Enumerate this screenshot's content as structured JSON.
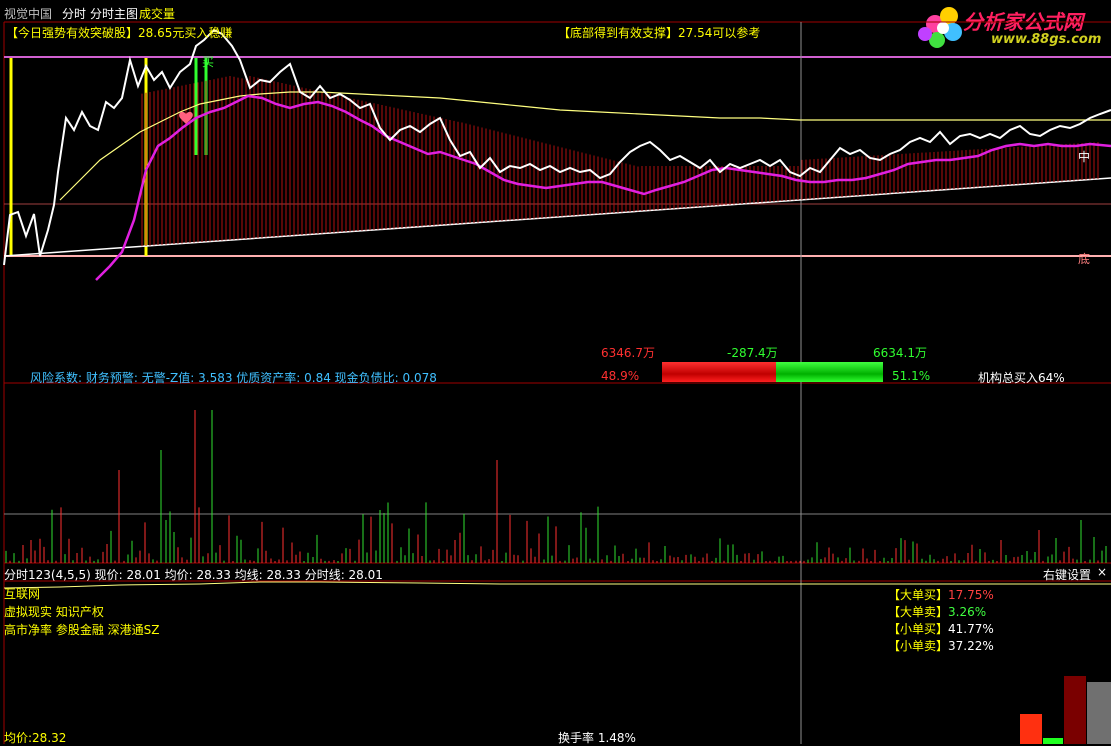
{
  "menu": {
    "items": [
      "视觉中国",
      "分时",
      "分时主图",
      "成交量"
    ],
    "colors": [
      "#c0c0c0",
      "#ffffff",
      "#ffffff",
      "#ffff00"
    ]
  },
  "main_chart": {
    "signal_left": "【今日强势有效突破股】28.65元买入稳赚",
    "signal_right": "【底部得到有效支撑】27.54可以参考",
    "label_mid": "中",
    "label_bottom": "底",
    "buy_tag": "买"
  },
  "money_flow": {
    "left_value": "6346.7万",
    "mid_value": "-287.4万",
    "right_value": "6634.1万",
    "left_pct": "48.9%",
    "right_pct": "51.1%",
    "inst_text": "机构总买入64%",
    "risk_text": "风险系数: 财务预警: 无警-Z值: 3.583 优质资产率: 0.84 现金负债比: 0.078"
  },
  "indicator_bar": {
    "text": "分时123(4,5,5) 现价: 28.01 均价: 28.33 均线: 28.33 分时线: 28.01",
    "settings": "右键设置",
    "close": "×"
  },
  "bottom_panel": {
    "concepts": [
      "互联网",
      "虚拟现实 知识产权",
      "高市净率 参股金融 深港通SZ"
    ],
    "orders": [
      {
        "label": "【大单买】",
        "value": "17.75%",
        "color": "#ff4040"
      },
      {
        "label": "【大单卖】",
        "value": "3.26%",
        "color": "#40ff40"
      },
      {
        "label": "【小单买】",
        "value": "41.77%",
        "color": "#ffffff"
      },
      {
        "label": "【小单卖】",
        "value": "37.22%",
        "color": "#ffffff"
      }
    ],
    "avg_price": "均价:28.32",
    "turnover": "换手率 1.48%"
  },
  "logo": {
    "title": "分析家公式网",
    "url": "www.88gs.com"
  },
  "colors": {
    "price_line": "#ffffff",
    "avg_line": "#ffff80",
    "ma_line": "#e020e0",
    "red": "#ff3030",
    "green": "#30ff30",
    "frame": "#a00000"
  }
}
